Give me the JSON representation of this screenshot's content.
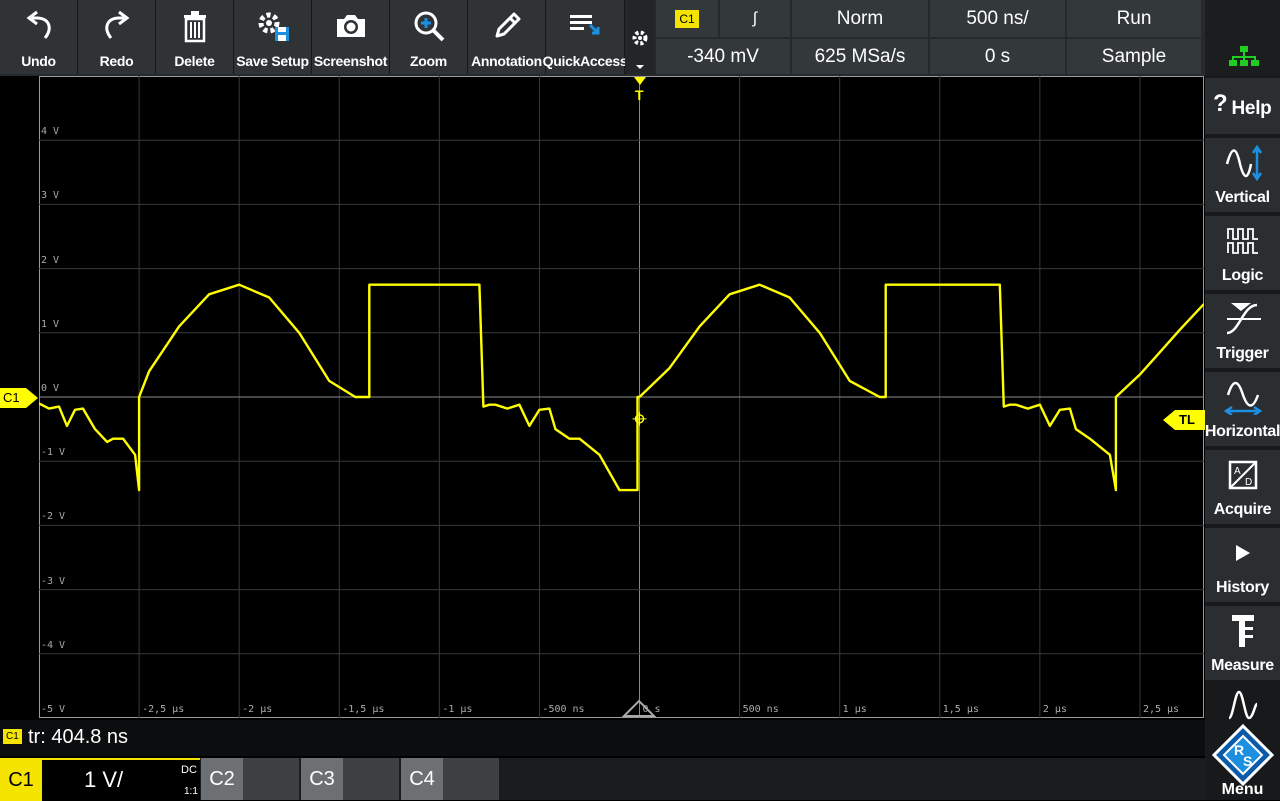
{
  "toolbar": {
    "buttons": [
      {
        "label": "Undo",
        "icon": "undo-icon"
      },
      {
        "label": "Redo",
        "icon": "redo-icon"
      },
      {
        "label": "Delete",
        "icon": "trash-icon"
      },
      {
        "label": "Save Setup",
        "icon": "save-setup-icon"
      },
      {
        "label": "Screenshot",
        "icon": "camera-icon"
      },
      {
        "label": "Zoom",
        "icon": "zoom-icon"
      },
      {
        "label": "Annotation",
        "icon": "pencil-icon"
      },
      {
        "label": "QuickAccess",
        "icon": "quickaccess-icon"
      }
    ]
  },
  "trigger_info": {
    "source": "C1",
    "slope": "∫",
    "mode": "Norm",
    "level": "-340 mV",
    "sample_rate": "625 MSa/s",
    "timebase": "500 ns/",
    "position": "0 s",
    "run_state": "Run",
    "acquire_mode": "Sample"
  },
  "side_menu": [
    {
      "label": "Help",
      "icon": "help-icon"
    },
    {
      "label": "Vertical",
      "icon": "vertical-icon"
    },
    {
      "label": "Logic",
      "icon": "logic-icon"
    },
    {
      "label": "Trigger",
      "icon": "trigger-icon"
    },
    {
      "label": "Horizontal",
      "icon": "horizontal-icon"
    },
    {
      "label": "Acquire",
      "icon": "acquire-icon"
    },
    {
      "label": "History",
      "icon": "play-icon"
    },
    {
      "label": "Measure",
      "icon": "measure-icon"
    },
    {
      "label": "Menu",
      "icon": "rs-logo-icon"
    }
  ],
  "grid": {
    "y_labels": [
      "4 V",
      "3 V",
      "2 V",
      "1 V",
      "0 V",
      "-1 V",
      "-2 V",
      "-3 V",
      "-4 V",
      "-5 V"
    ],
    "x_labels": [
      "-2,5 µs",
      "-2 µs",
      "-1,5 µs",
      "-1 µs",
      "-500 ns",
      "0 s",
      "500 ns",
      "1 µs",
      "1,5 µs",
      "2 µs",
      "2,5 µs"
    ]
  },
  "markers": {
    "channel_marker": "C1",
    "trigger_level_marker": "TL",
    "trigger_pos_marker": "T"
  },
  "measurement": {
    "channel": "C1",
    "text": "tr: 404.8 ns"
  },
  "channels": [
    {
      "name": "C1",
      "scale": "1 V/",
      "coupling": "DC",
      "ratio": "1:1",
      "active": true
    },
    {
      "name": "C2",
      "active": false
    },
    {
      "name": "C3",
      "active": false
    },
    {
      "name": "C4",
      "active": false
    }
  ],
  "colors": {
    "trace": "#ffff00",
    "channel_accent": "#f5e400",
    "network_icon": "#22cc22",
    "toolbar_bg": "#2f3336"
  },
  "chart_data": {
    "type": "line",
    "xlabel": "",
    "ylabel": "",
    "x_unit": "µs",
    "y_unit": "V",
    "xlim": [
      -3.0,
      2.82
    ],
    "ylim": [
      -5,
      5
    ],
    "grid": true,
    "series": [
      {
        "x": [
          -3.0,
          -2.95,
          -2.9,
          -2.86,
          -2.82,
          -2.78,
          -2.72,
          -2.66,
          -2.63,
          -2.58,
          -2.52,
          -2.5,
          -2.5,
          -2.45,
          -2.3,
          -2.15,
          -2.0,
          -1.85,
          -1.7,
          -1.55,
          -1.42,
          -1.35,
          -1.35,
          -1.2,
          -1.0,
          -0.8,
          -0.78,
          -0.75,
          -0.72,
          -0.66,
          -0.6,
          -0.55,
          -0.5,
          -0.45,
          -0.42,
          -0.35,
          -0.3,
          -0.2,
          -0.1,
          -0.01,
          -0.01,
          0.0
        ],
        "y": [
          -0.1,
          -0.18,
          -0.15,
          -0.45,
          -0.2,
          -0.18,
          -0.5,
          -0.7,
          -0.65,
          -0.65,
          -0.9,
          -1.45,
          0.0,
          0.4,
          1.1,
          1.6,
          1.75,
          1.55,
          1.0,
          0.25,
          0.0,
          0.0,
          1.75,
          1.75,
          1.75,
          1.75,
          -0.15,
          -0.12,
          -0.12,
          -0.18,
          -0.12,
          -0.45,
          -0.2,
          -0.18,
          -0.5,
          -0.65,
          -0.65,
          -0.9,
          -1.45,
          -1.45,
          0.0,
          0.0
        ]
      },
      {
        "x": [
          0.0,
          0.15,
          0.3,
          0.45,
          0.6,
          0.75,
          0.9,
          1.05,
          1.2,
          1.23,
          1.23,
          1.4,
          1.6,
          1.8,
          1.82,
          1.85,
          1.88,
          1.94,
          2.0,
          2.05,
          2.1,
          2.15,
          2.18,
          2.25,
          2.35,
          2.38,
          2.38,
          2.5,
          2.6,
          2.7,
          2.82
        ],
        "y": [
          0.0,
          0.45,
          1.1,
          1.6,
          1.75,
          1.55,
          1.0,
          0.25,
          0.0,
          0.0,
          1.75,
          1.75,
          1.75,
          1.75,
          -0.15,
          -0.12,
          -0.12,
          -0.18,
          -0.12,
          -0.45,
          -0.2,
          -0.18,
          -0.5,
          -0.65,
          -0.9,
          -1.45,
          0.0,
          0.35,
          0.7,
          1.05,
          1.45
        ]
      }
    ]
  }
}
